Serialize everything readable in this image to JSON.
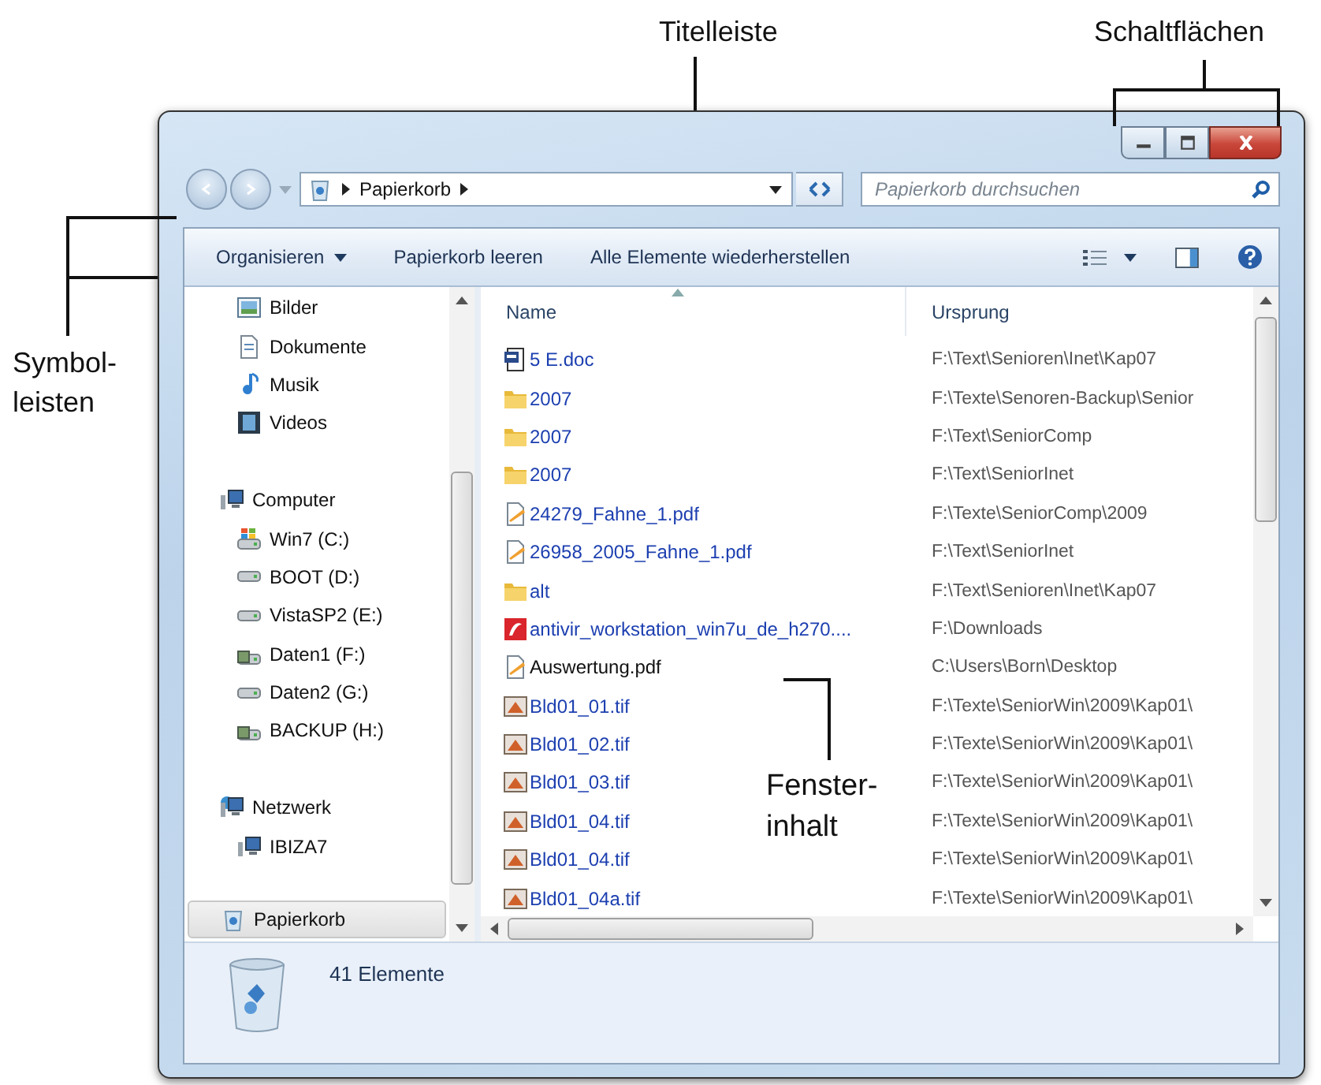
{
  "annotations": [
    {
      "kind": "title",
      "text": "Titelleiste"
    },
    {
      "kind": "buttons",
      "text": "Schaltflächen"
    },
    {
      "kind": "toolbars",
      "text": "Symbol-leisten"
    },
    {
      "kind": "content",
      "text": "Fenster-inhalt"
    }
  ],
  "address_bar": {
    "crumbs": [
      "Papierkorb"
    ]
  },
  "search": {
    "placeholder": "Papierkorb durchsuchen"
  },
  "toolbar": [
    {
      "label": "Organisieren",
      "kind": "menu"
    },
    {
      "label": "Papierkorb leeren",
      "kind": "command"
    },
    {
      "label": "Alle Elemente wiederherstellen",
      "kind": "command"
    }
  ],
  "nav_pane": {
    "tree": [
      {
        "children": [
          {
            "label": "Bilder",
            "kind": "pictures"
          },
          {
            "label": "Dokumente",
            "kind": "documents"
          },
          {
            "label": "Musik",
            "kind": "music"
          },
          {
            "label": "Videos",
            "kind": "videos"
          }
        ]
      },
      {
        "label": "Computer",
        "kind": "computer",
        "children": [
          {
            "label": "Win7 (C:)",
            "kind": "system-drive"
          },
          {
            "label": "BOOT (D:)",
            "kind": "drive"
          },
          {
            "label": "VistaSP2 (E:)",
            "kind": "drive"
          },
          {
            "label": "Daten1 (F:)",
            "kind": "network-drive"
          },
          {
            "label": "Daten2 (G:)",
            "kind": "drive"
          },
          {
            "label": "BACKUP (H:)",
            "kind": "network-drive"
          }
        ]
      },
      {
        "label": "Netzwerk",
        "kind": "network",
        "children": [
          {
            "label": "IBIZA7",
            "kind": "computer"
          }
        ]
      }
    ],
    "footer_item": {
      "label": "Papierkorb",
      "kind": "recycle-bin",
      "selected": true
    }
  },
  "file_list": {
    "columns": [
      {
        "label": "Name",
        "sorted": true
      },
      {
        "label": "Ursprung",
        "sorted": false
      }
    ],
    "rows": [
      {
        "name": "5 E.doc",
        "origin": "F:\\Text\\Senioren\\Inet\\Kap07",
        "kind": "doc",
        "compressed": true
      },
      {
        "name": "2007",
        "origin": "F:\\Texte\\Senoren-Backup\\Senior",
        "kind": "folder",
        "compressed": true
      },
      {
        "name": "2007",
        "origin": "F:\\Text\\SeniorComp",
        "kind": "folder",
        "compressed": true
      },
      {
        "name": "2007",
        "origin": "F:\\Text\\SeniorInet",
        "kind": "folder",
        "compressed": true
      },
      {
        "name": "24279_Fahne_1.pdf",
        "origin": "F:\\Texte\\SeniorComp\\2009",
        "kind": "pdf",
        "compressed": true
      },
      {
        "name": "26958_2005_Fahne_1.pdf",
        "origin": "F:\\Text\\SeniorInet",
        "kind": "pdf",
        "compressed": true
      },
      {
        "name": "alt",
        "origin": "F:\\Text\\Senioren\\Inet\\Kap07",
        "kind": "folder",
        "compressed": true
      },
      {
        "name": "antivir_workstation_win7u_de_h270....",
        "origin": "F:\\Downloads",
        "kind": "app",
        "compressed": true
      },
      {
        "name": "Auswertung.pdf",
        "origin": "C:\\Users\\Born\\Desktop",
        "kind": "pdf",
        "compressed": false
      },
      {
        "name": "Bld01_01.tif",
        "origin": "F:\\Texte\\SeniorWin\\2009\\Kap01\\",
        "kind": "image",
        "compressed": true
      },
      {
        "name": "Bld01_02.tif",
        "origin": "F:\\Texte\\SeniorWin\\2009\\Kap01\\",
        "kind": "image",
        "compressed": true
      },
      {
        "name": "Bld01_03.tif",
        "origin": "F:\\Texte\\SeniorWin\\2009\\Kap01\\",
        "kind": "image",
        "compressed": true
      },
      {
        "name": "Bld01_04.tif",
        "origin": "F:\\Texte\\SeniorWin\\2009\\Kap01\\",
        "kind": "image",
        "compressed": true
      },
      {
        "name": "Bld01_04.tif",
        "origin": "F:\\Texte\\SeniorWin\\2009\\Kap01\\",
        "kind": "image",
        "compressed": true
      },
      {
        "name": "Bld01_04a.tif",
        "origin": "F:\\Texte\\SeniorWin\\2009\\Kap01\\",
        "kind": "image",
        "compressed": true
      }
    ]
  },
  "status_bar": {
    "count": "41 Elemente"
  }
}
